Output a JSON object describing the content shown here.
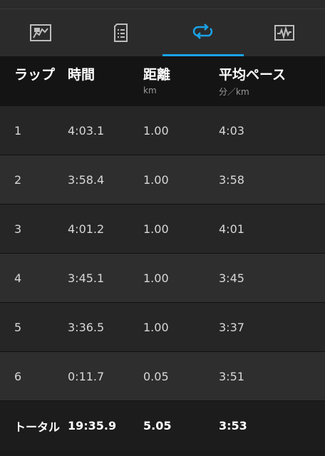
{
  "colors": {
    "accent": "#1aa3e8",
    "icon": "#bdbdbd"
  },
  "tabs": [
    {
      "icon": "map-icon",
      "active": false
    },
    {
      "icon": "details-icon",
      "active": false
    },
    {
      "icon": "laps-icon",
      "active": true
    },
    {
      "icon": "chart-icon",
      "active": false
    }
  ],
  "table": {
    "headers": {
      "lap": "ラップ",
      "time": "時間",
      "distance": "距離",
      "distance_unit": "km",
      "pace": "平均ペース",
      "pace_unit": "分／km"
    },
    "rows": [
      {
        "lap": "1",
        "time": "4:03.1",
        "distance": "1.00",
        "pace": "4:03"
      },
      {
        "lap": "2",
        "time": "3:58.4",
        "distance": "1.00",
        "pace": "3:58"
      },
      {
        "lap": "3",
        "time": "4:01.2",
        "distance": "1.00",
        "pace": "4:01"
      },
      {
        "lap": "4",
        "time": "3:45.1",
        "distance": "1.00",
        "pace": "3:45"
      },
      {
        "lap": "5",
        "time": "3:36.5",
        "distance": "1.00",
        "pace": "3:37"
      },
      {
        "lap": "6",
        "time": "0:11.7",
        "distance": "0.05",
        "pace": "3:51"
      }
    ],
    "total": {
      "label": "トータル",
      "time": "19:35.9",
      "distance": "5.05",
      "pace": "3:53"
    }
  }
}
